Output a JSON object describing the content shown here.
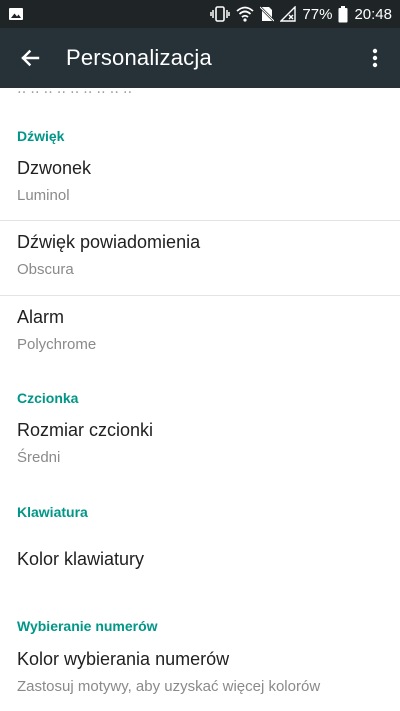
{
  "status_bar": {
    "battery_percent": "77%",
    "time": "20:48",
    "icons": [
      "image-icon",
      "vibrate-icon",
      "wifi-icon",
      "no-sim-icon",
      "signal-off-icon",
      "battery-icon"
    ]
  },
  "app_bar": {
    "title": "Personalizacja",
    "icons": [
      "back-arrow-icon",
      "more-vert-icon"
    ]
  },
  "sections": {
    "sound": {
      "header": "Dźwięk",
      "ringtone": {
        "title": "Dzwonek",
        "value": "Luminol"
      },
      "notification": {
        "title": "Dźwięk powiadomienia",
        "value": "Obscura"
      },
      "alarm": {
        "title": "Alarm",
        "value": "Polychrome"
      }
    },
    "font": {
      "header": "Czcionka",
      "font_size": {
        "title": "Rozmiar czcionki",
        "value": "Średni"
      }
    },
    "keyboard": {
      "header": "Klawiatura",
      "keyboard_color": {
        "title": "Kolor klawiatury"
      }
    },
    "dialer": {
      "header": "Wybieranie numerów",
      "dialer_color": {
        "title": "Kolor wybierania numerów",
        "value": "Zastosuj motywy, aby uzyskać więcej kolorów"
      }
    }
  },
  "colors": {
    "accent": "#009688",
    "app_bar": "#263238",
    "status_bar": "#1f2427"
  }
}
